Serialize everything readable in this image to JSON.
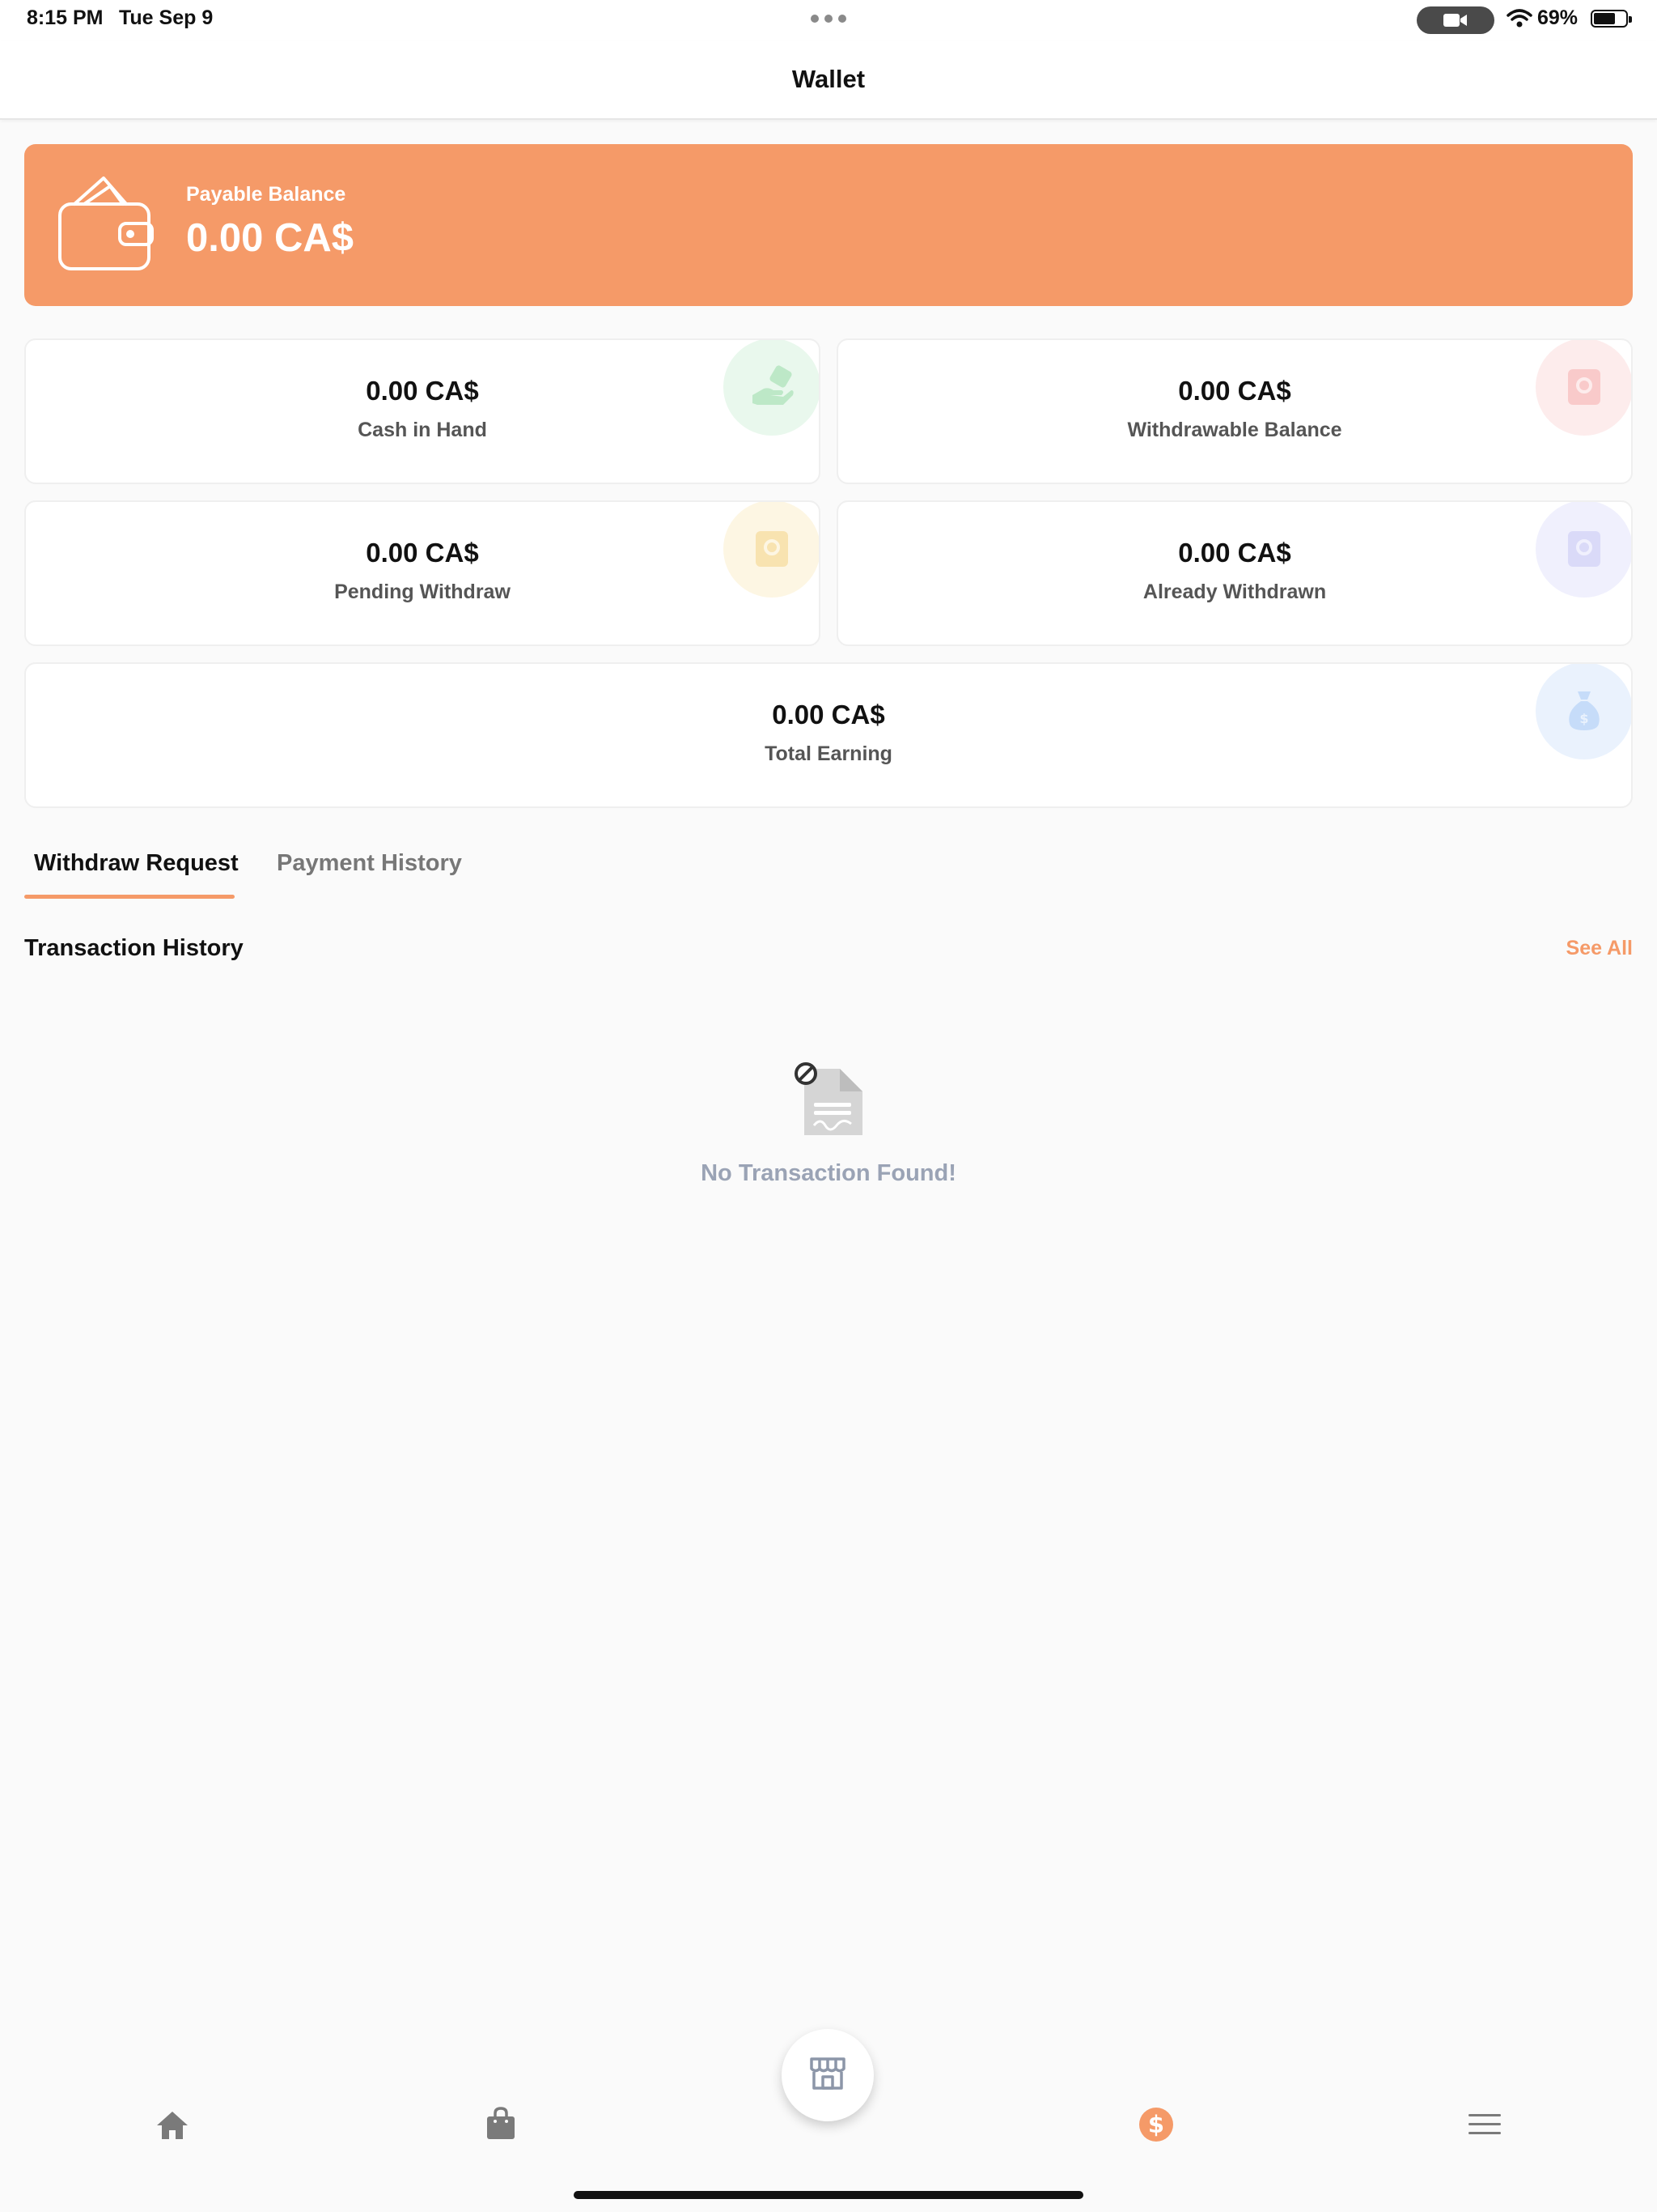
{
  "status_bar": {
    "time": "8:15 PM",
    "date": "Tue Sep 9",
    "battery_percent": "69%",
    "battery_level": 0.69,
    "icons": [
      "camera-icon",
      "wifi-icon",
      "battery-icon"
    ]
  },
  "header": {
    "title": "Wallet"
  },
  "payable": {
    "label": "Payable Balance",
    "amount": "0.00 CA$"
  },
  "stats": [
    {
      "amount": "0.00 CA$",
      "label": "Cash in Hand",
      "icon": "cash-hand-icon",
      "color": "#4cc46a"
    },
    {
      "amount": "0.00 CA$",
      "label": "Withdrawable Balance",
      "icon": "safe-icon",
      "color": "#f06b6b"
    },
    {
      "amount": "0.00 CA$",
      "label": "Pending Withdraw",
      "icon": "safe-icon",
      "color": "#f5c24a"
    },
    {
      "amount": "0.00 CA$",
      "label": "Already Withdrawn",
      "icon": "safe-icon",
      "color": "#8e8ef0"
    },
    {
      "amount": "0.00 CA$",
      "label": "Total Earning",
      "icon": "money-bag-icon",
      "color": "#6aa5f5"
    }
  ],
  "tabs": [
    {
      "label": "Withdraw Request",
      "active": true
    },
    {
      "label": "Payment History",
      "active": false
    }
  ],
  "transactions": {
    "title": "Transaction History",
    "see_all": "See All",
    "empty_message": "No Transaction Found!"
  },
  "bottom_nav": {
    "items": [
      "home-icon",
      "shopping-bag-icon",
      "store-icon",
      "dollar-icon",
      "menu-icon"
    ],
    "active": "dollar-icon"
  },
  "colors": {
    "accent": "#f59a68",
    "empty_text": "#9aa3b5"
  }
}
